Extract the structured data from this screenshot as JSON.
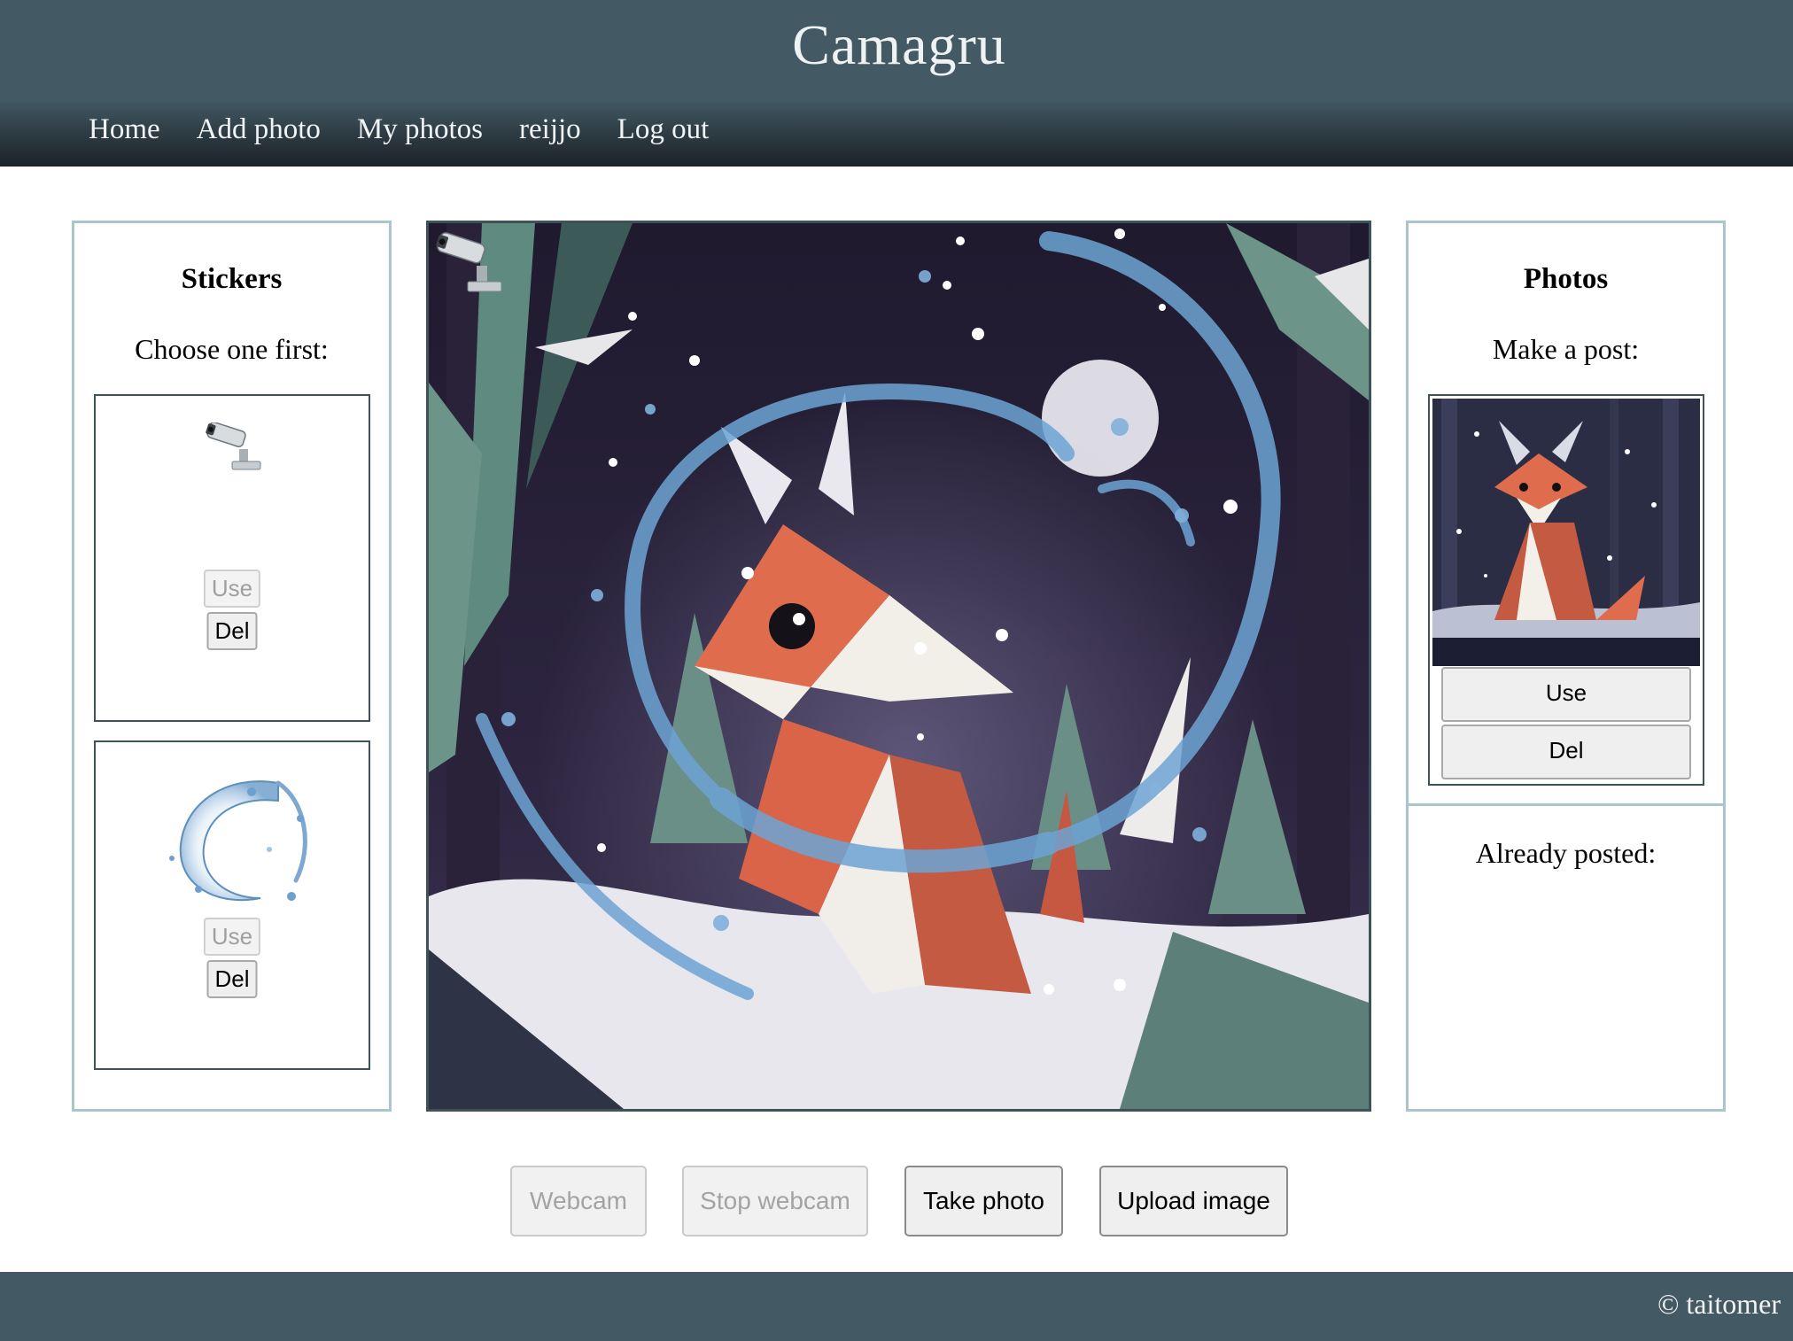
{
  "app": {
    "title": "Camagru"
  },
  "nav": {
    "items": [
      "Home",
      "Add photo",
      "My photos",
      "reijjo",
      "Log out"
    ]
  },
  "stickers": {
    "title": "Stickers",
    "subtitle": "Choose one first:",
    "items": [
      {
        "icon": "security-camera-icon",
        "use_label": "Use",
        "del_label": "Del"
      },
      {
        "icon": "water-splash-icon",
        "use_label": "Use",
        "del_label": "Del"
      }
    ]
  },
  "photos": {
    "title": "Photos",
    "make_post": "Make a post:",
    "use_label": "Use",
    "del_label": "Del",
    "already_posted": "Already posted:"
  },
  "controls": {
    "webcam": "Webcam",
    "stop_webcam": "Stop webcam",
    "take_photo": "Take photo",
    "upload_image": "Upload image"
  },
  "footer": {
    "text": "© taitomer"
  },
  "colors": {
    "header": "#435a64",
    "panel_border": "#a8c6cb",
    "card_border": "#3f525a"
  }
}
